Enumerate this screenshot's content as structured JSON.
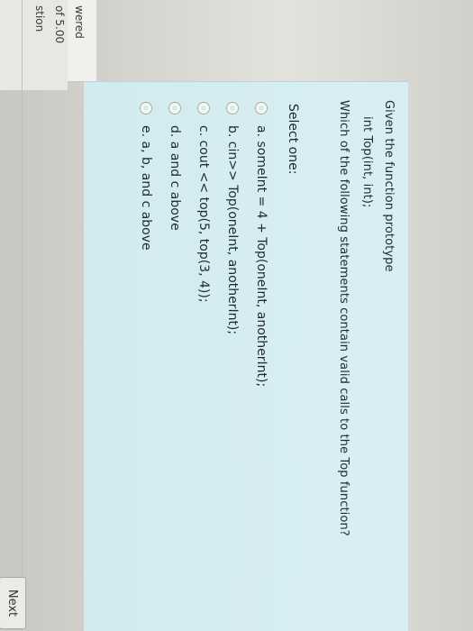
{
  "sidebar": {
    "line1": "wered",
    "line2": "of 5.00",
    "line3": "stion"
  },
  "question": {
    "line1": "Given the function prototype",
    "line2": "int Top(int, int);",
    "line3": "Which of the following statements contain valid calls to the Top function?",
    "select_label": "Select one:"
  },
  "options": [
    {
      "text": "a. someInt = 4 + Top(oneInt, anotherInt);"
    },
    {
      "text": "b. cin>> Top(oneInt, anotherInt);"
    },
    {
      "text": "c. cout << top(5, top(3, 4));"
    },
    {
      "text": "d. a and c above"
    },
    {
      "text": "e. a, b, and c above"
    }
  ],
  "navigation": {
    "next_label": "Next"
  }
}
